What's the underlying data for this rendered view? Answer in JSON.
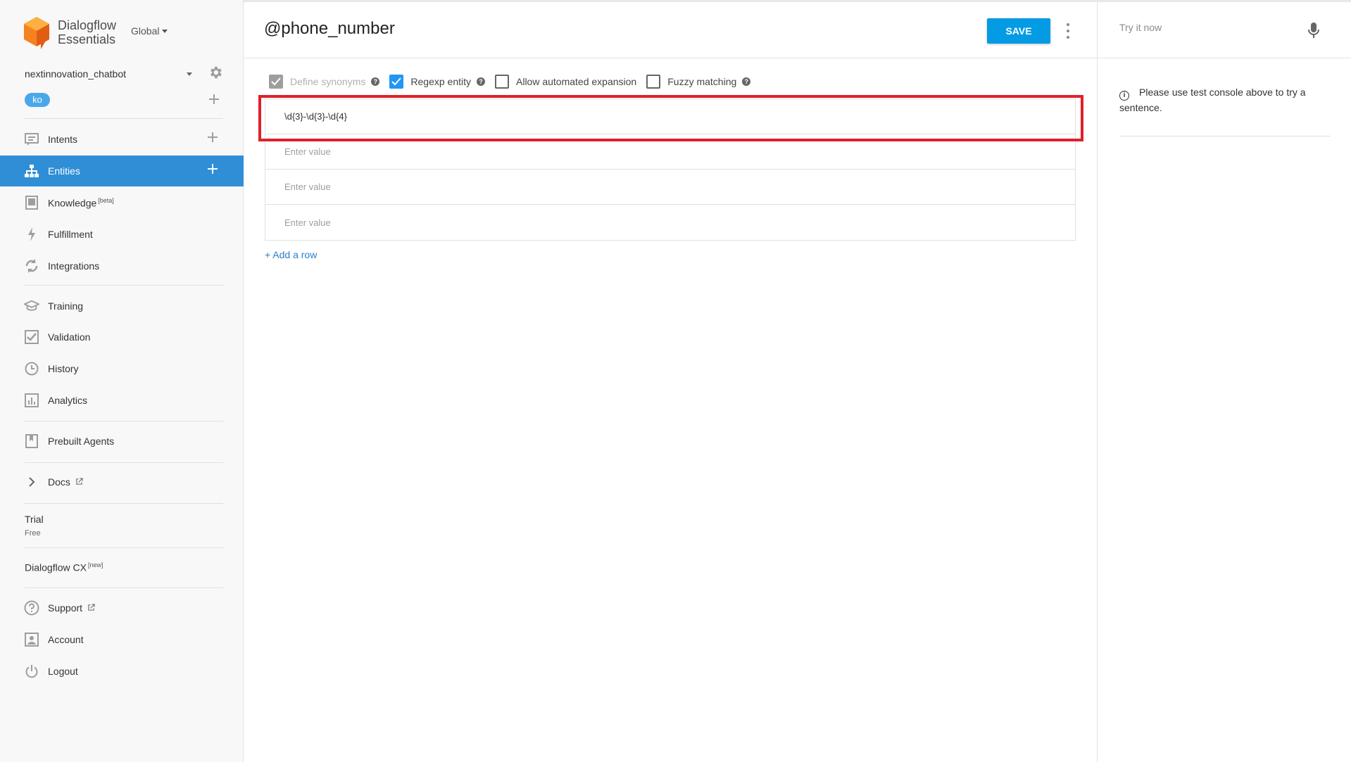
{
  "brand": {
    "line1": "Dialogflow",
    "line2": "Essentials",
    "region": "Global"
  },
  "agent": {
    "name": "nextinnovation_chatbot",
    "language": "ko"
  },
  "nav": {
    "intents": "Intents",
    "entities": "Entities",
    "knowledge": "Knowledge",
    "knowledge_tag": "[beta]",
    "fulfillment": "Fulfillment",
    "integrations": "Integrations",
    "training": "Training",
    "validation": "Validation",
    "history": "History",
    "analytics": "Analytics",
    "prebuilt_agents": "Prebuilt Agents",
    "docs": "Docs"
  },
  "trial": {
    "label": "Trial",
    "plan": "Free"
  },
  "cx": {
    "label": "Dialogflow CX",
    "tag": "[new]"
  },
  "bottom_nav": {
    "support": "Support",
    "account": "Account",
    "logout": "Logout"
  },
  "entity": {
    "title": "@phone_number",
    "save_label": "SAVE",
    "options": {
      "define_synonyms": "Define synonyms",
      "regexp_entity": "Regexp entity",
      "allow_automated_expansion": "Allow automated expansion",
      "fuzzy_matching": "Fuzzy matching"
    },
    "rows": [
      {
        "value": "\\d{3}-\\d{3}-\\d{4}",
        "placeholder": "Enter value"
      },
      {
        "value": "",
        "placeholder": "Enter value"
      },
      {
        "value": "",
        "placeholder": "Enter value"
      },
      {
        "value": "",
        "placeholder": "Enter value"
      }
    ],
    "add_row": "+ Add a row"
  },
  "test_console": {
    "placeholder": "Try it now",
    "info": "Please use test console above to try a sentence."
  },
  "colors": {
    "accent": "#049be5",
    "active_nav": "#2f8ed6",
    "highlight": "#e0202b",
    "logo": "#f58220"
  },
  "icons": [
    "dialogflow-logo-icon",
    "gear-icon",
    "chat-icon",
    "entity-tree-icon",
    "book-icon",
    "bolt-icon",
    "sync-icon",
    "graduation-cap-icon",
    "check-box-icon",
    "clock-icon",
    "bar-chart-icon",
    "agent-book-icon",
    "chevron-right-icon",
    "external-link-icon",
    "help-icon",
    "account-box-icon",
    "power-icon",
    "mic-icon",
    "info-icon"
  ]
}
